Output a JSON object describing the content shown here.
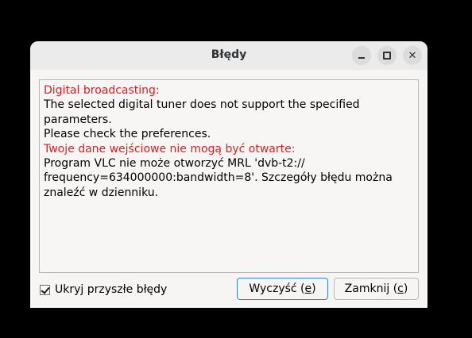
{
  "window": {
    "title": "Błędy",
    "minimize_icon": "minimize-icon",
    "maximize_icon": "maximize-icon",
    "close_icon": "close-icon"
  },
  "errors": [
    {
      "title": "Digital broadcasting:",
      "message": "The selected digital tuner does not support the specified\nparameters.\nPlease check the preferences."
    },
    {
      "title": "Twoje dane wejściowe nie mogą być otwarte:",
      "message": "Program VLC nie może otworzyć MRL 'dvb-t2://\nfrequency=634000000:bandwidth=8'. Szczegóły błędu można\nznaleźć w dzienniku."
    }
  ],
  "footer": {
    "suppress_label": "Ukryj przyszłe błędy",
    "suppress_checked": true,
    "clear_label_pre": "Wyczyść (",
    "clear_mnemonic": "e",
    "clear_label_post": ")",
    "close_label_pre": "Zamknij (",
    "close_mnemonic": "c",
    "close_label_post": ")"
  },
  "colors": {
    "error_title": "#e01b24",
    "focus_border": "#3584e4"
  }
}
